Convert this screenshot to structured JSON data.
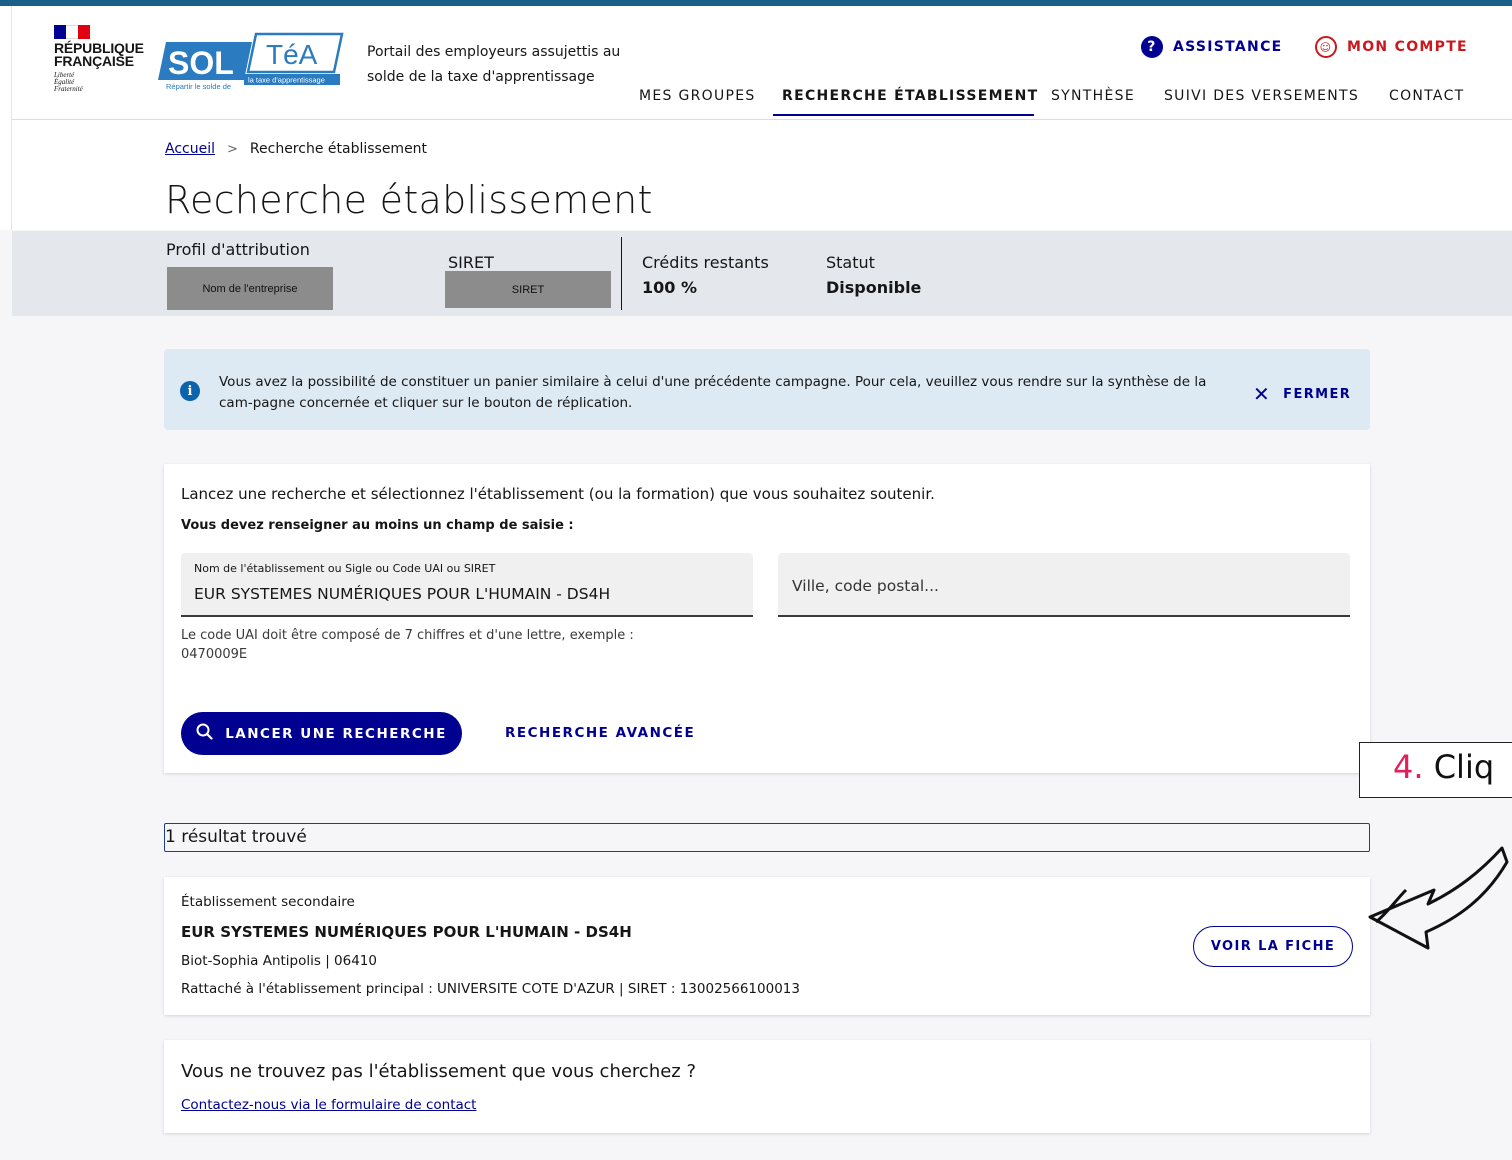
{
  "header": {
    "rf_title_1": "RÉPUBLIQUE",
    "rf_title_2": "FRANÇAISE",
    "rf_motto_1": "Liberté",
    "rf_motto_2": "Égalité",
    "rf_motto_3": "Fraternité",
    "logo_sol": "SOL",
    "logo_tea": "TéA",
    "logo_sub_left": "Répartir le solde de",
    "logo_sub_right": "la taxe d'apprentissage",
    "tagline": "Portail des employeurs assujettis au solde de la taxe d'apprentissage",
    "assistance": "ASSISTANCE",
    "account": "MON COMPTE",
    "nav": [
      "MES GROUPES",
      "RECHERCHE ÉTABLISSEMENT",
      "SYNTHÈSE",
      "SUIVI DES VERSEMENTS",
      "CONTACT"
    ]
  },
  "breadcrumb": {
    "home": "Accueil",
    "current": "Recherche établissement"
  },
  "page_title": "Recherche établissement",
  "profile": {
    "label": "Profil d'attribution",
    "company_placeholder": "Nom de l'entreprise",
    "siret_label": "SIRET",
    "siret_placeholder": "SIRET",
    "credits_label": "Crédits restants",
    "credits_value": "100 %",
    "status_label": "Statut",
    "status_value": "Disponible"
  },
  "alert": {
    "text": "Vous avez la possibilité de constituer un panier similaire à celui d'une précédente campagne. Pour cela, veuillez vous rendre sur la synthèse de la cam-pagne concernée et cliquer sur le bouton de réplication.",
    "close": "FERMER"
  },
  "search": {
    "intro": "Lancez une recherche et sélectionnez l'établissement (ou la formation) que vous souhaitez soutenir.",
    "required": "Vous devez renseigner au moins un champ de saisie :",
    "name_label": "Nom de l'établissement ou Sigle ou Code UAI ou SIRET",
    "name_value": "EUR SYSTEMES NUMÉRIQUES POUR L'HUMAIN - DS4H",
    "city_placeholder": "Ville, code postal...",
    "hint": "Le code UAI doit être composé de 7 chiffres et d'une lettre, exemple : 0470009E",
    "submit": "LANCER UNE RECHERCHE",
    "advanced": "RECHERCHE AVANCÉE"
  },
  "results": {
    "count": "1 résultat trouvé",
    "items": [
      {
        "type": "Établissement secondaire",
        "name": "EUR SYSTEMES NUMÉRIQUES POUR L'HUMAIN - DS4H",
        "location": "Biot-Sophia Antipolis | 06410",
        "attach": "Rattaché à l'établissement principal : UNIVERSITE COTE D'AZUR | SIRET : 13002566100013",
        "button": "VOIR LA FICHE"
      }
    ]
  },
  "not_found": {
    "title": "Vous ne trouvez pas l'établissement que vous cherchez ?",
    "link": "Contactez-nous via le formulaire de contact"
  },
  "annotation": {
    "number": "4.",
    "text": "Cliq"
  },
  "colors": {
    "primary": "#000091",
    "accent_red": "#c9191e",
    "info": "#0a63ac",
    "flag_blue": "#000091",
    "flag_red": "#e1000f"
  },
  "icons": {
    "assistance": "question-circle-icon",
    "account": "user-circle-icon",
    "info": "info-icon",
    "close": "close-icon",
    "search": "search-icon",
    "arrow": "hand-drawn-arrow-icon"
  }
}
